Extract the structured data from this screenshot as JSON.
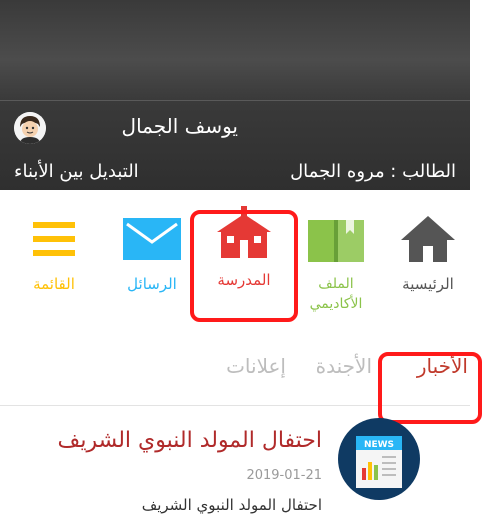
{
  "header": {
    "user_name": "يوسف الجمال",
    "student_label": "الطالب : مروه الجمال",
    "switch_children": "التبديل بين الأبناء"
  },
  "nav": [
    {
      "label": "الرئيسية",
      "icon": "home-icon",
      "color": "#555555"
    },
    {
      "label": "الملف الأكاديمي",
      "icon": "book-icon",
      "color": "#8bc34a"
    },
    {
      "label": "المدرسة",
      "icon": "school-icon",
      "color": "#e53935"
    },
    {
      "label": "الرسائل",
      "icon": "envelope-icon",
      "color": "#29b6f6"
    },
    {
      "label": "القائمة",
      "icon": "menu-icon",
      "color": "#ffc107"
    }
  ],
  "tabs": [
    {
      "label": "الأخبار",
      "active": true
    },
    {
      "label": "الأجندة",
      "active": false
    },
    {
      "label": "إعلانات",
      "active": false
    }
  ],
  "news": [
    {
      "title": "احتفال المولد النبوي الشريف",
      "date": "2019-01-21",
      "description": "احتفال المولد النبوي الشريف",
      "icon": "news-icon",
      "icon_text": "NEWS"
    }
  ],
  "colors": {
    "header_bg": "#3a3a3a",
    "highlight": "#ff1a1a",
    "active_tab": "#c0392b",
    "inactive_tab": "#bdbdbd"
  }
}
